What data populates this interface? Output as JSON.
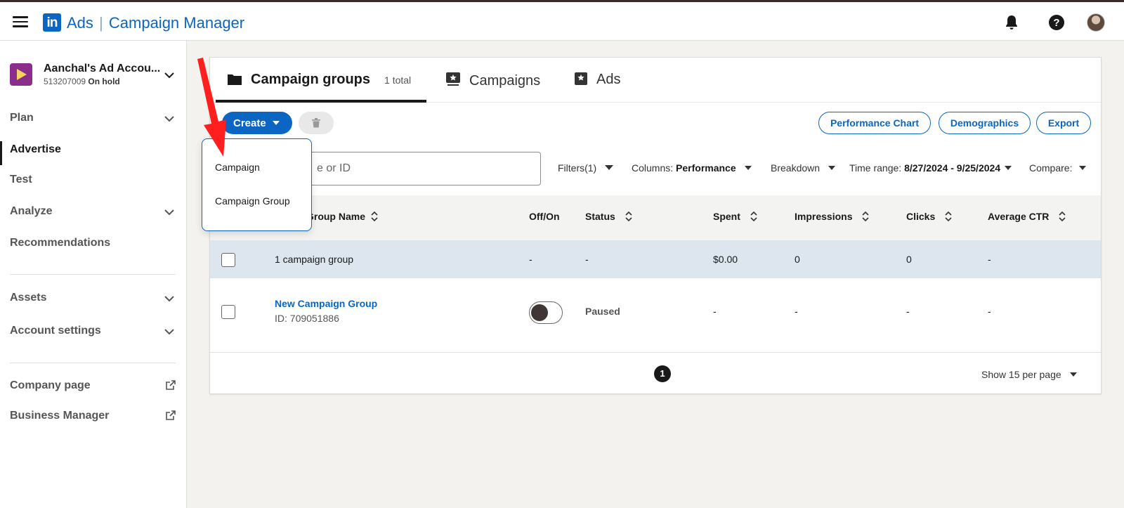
{
  "header": {
    "logo_text": "in",
    "app_name": "Ads",
    "separator": "|",
    "product_name": "Campaign Manager",
    "icons": [
      "menu-icon",
      "notifications-bell-icon",
      "help-icon",
      "profile-avatar"
    ]
  },
  "account": {
    "name": "Aanchal's Ad Accou...",
    "id": "513207009",
    "status": "On hold"
  },
  "sidebar": {
    "items": [
      {
        "label": "Plan"
      },
      {
        "label": "Advertise"
      },
      {
        "label": "Test"
      },
      {
        "label": "Analyze"
      },
      {
        "label": "Recommendations"
      },
      {
        "label": "Assets"
      },
      {
        "label": "Account settings"
      },
      {
        "label": "Company page"
      },
      {
        "label": "Business Manager"
      }
    ],
    "active": "Advertise"
  },
  "tabs": [
    {
      "label": "Campaign groups",
      "count": "1 total"
    },
    {
      "label": "Campaigns"
    },
    {
      "label": "Ads"
    }
  ],
  "toolbar": {
    "create_label": "Create",
    "performance_chart": "Performance Chart",
    "demographics": "Demographics",
    "export": "Export"
  },
  "dropdown": {
    "items": [
      "Campaign",
      "Campaign Group"
    ]
  },
  "search": {
    "placeholder_visible": "e or ID"
  },
  "filters": {
    "filters_label": "Filters(1)",
    "columns_label": "Columns:",
    "columns_value": "Performance",
    "breakdown_label": "Breakdown",
    "time_range_label": "Time range:",
    "time_range_value": "8/27/2024 - 9/25/2024",
    "compare_label": "Compare:"
  },
  "table": {
    "columns": [
      "gn Group Name",
      "Off/On",
      "Status",
      "Spent",
      "Impressions",
      "Clicks",
      "Average CTR"
    ],
    "summary_row": {
      "name": "1 campaign group",
      "offon": "-",
      "status": "-",
      "spent": "$0.00",
      "impressions": "0",
      "clicks": "0",
      "ctr": "-"
    },
    "rows": [
      {
        "name": "New Campaign Group",
        "id": "ID: 709051886",
        "toggle_on": false,
        "status": "Paused",
        "spent": "-",
        "impressions": "-",
        "clicks": "-",
        "ctr": "-"
      }
    ]
  },
  "pagination": {
    "current_page": "1",
    "per_page_label": "Show 15 per page"
  },
  "colors": {
    "brand": "#0a66c2",
    "summary_row_bg": "#dde6ef",
    "arrow": "#ff1f1f"
  }
}
